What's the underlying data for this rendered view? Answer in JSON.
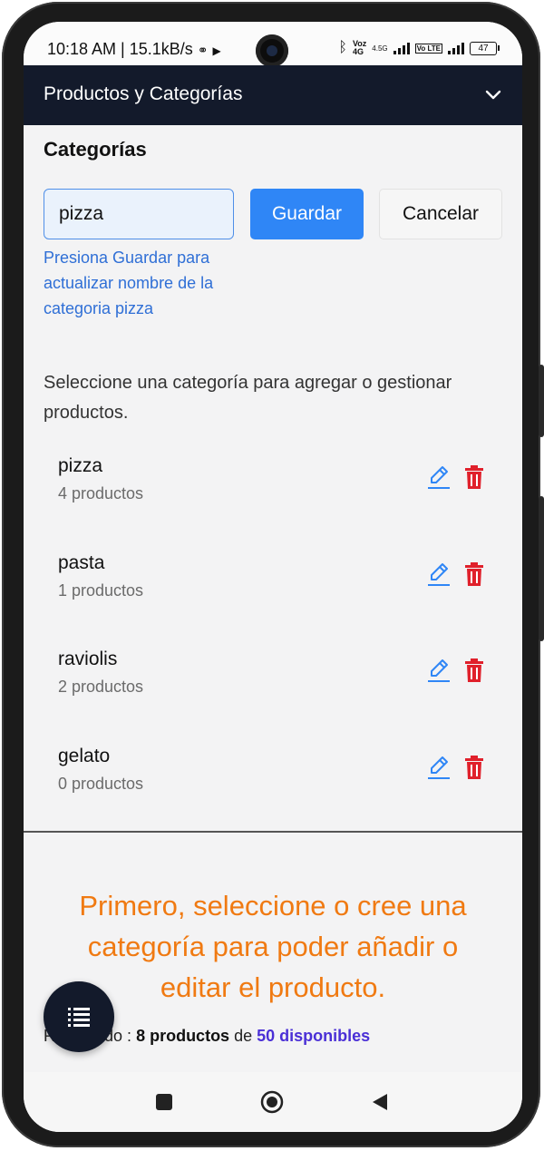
{
  "status_bar": {
    "time_speed": "10:18 AM | 15.1kB/s",
    "network_voz": "Voz",
    "network_4g": "4G",
    "network_45g": "4.5G",
    "volte": "Vo LTE",
    "battery": "47"
  },
  "app_bar": {
    "title": "Productos y Categorías"
  },
  "categories_section": {
    "title": "Categorías",
    "input_value": "pizza",
    "save_label": "Guardar",
    "cancel_label": "Cancelar",
    "hint": "Presiona Guardar para actualizar nombre de la categoria pizza",
    "instructions": "Seleccione una categoría para agregar o gestionar productos."
  },
  "categories": [
    {
      "name": "pizza",
      "count": "4 productos"
    },
    {
      "name": "pasta",
      "count": "1 productos"
    },
    {
      "name": "raviolis",
      "count": "2 productos"
    },
    {
      "name": "gelato",
      "count": "0 productos"
    }
  ],
  "warning": "Primero, seleccione o cree una categoría para poder añadir o editar el producto.",
  "summary": {
    "prefix": "Registrado : ",
    "used": "8 productos",
    "middle": " de ",
    "available": "50 disponibles"
  },
  "colors": {
    "app_bar": "#131a2b",
    "primary": "#2f86f6",
    "warning": "#f07a12",
    "delete": "#e0202b",
    "edit": "#2f86f6"
  }
}
